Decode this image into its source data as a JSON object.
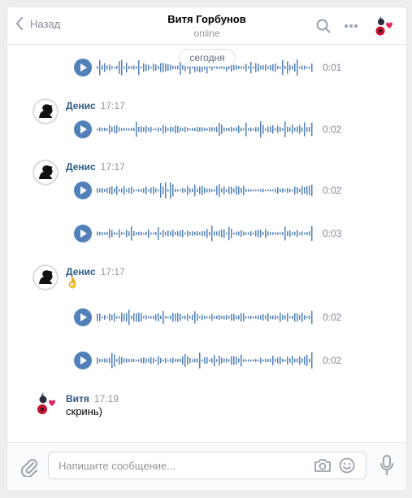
{
  "header": {
    "back_label": "Назад",
    "title": "Витя Горбунов",
    "status": "online"
  },
  "date_pill": "сегодня",
  "messages": [
    {
      "author": "Денис",
      "time": "17:17",
      "text": ""
    },
    {
      "author": "Денис",
      "time": "17:17",
      "text": ""
    },
    {
      "author": "Денис",
      "time": "17:17",
      "text": "👌"
    },
    {
      "author": "Витя",
      "time": "17:19",
      "text": "скринь)"
    }
  ],
  "voices": [
    {
      "duration": "0:01"
    },
    {
      "duration": "0:02"
    },
    {
      "duration": "0:02"
    },
    {
      "duration": "0:03"
    },
    {
      "duration": "0:02"
    },
    {
      "duration": "0:02"
    }
  ],
  "composer": {
    "placeholder": "Напишите сообщение..."
  },
  "colors": {
    "accent": "#5181b8",
    "author": "#2a5885",
    "muted": "#828a99",
    "background": "#edeef0"
  },
  "icons": [
    "chevron-left-icon",
    "search-icon",
    "more-icon",
    "attach-icon",
    "camera-icon",
    "smile-icon",
    "microphone-icon"
  ]
}
